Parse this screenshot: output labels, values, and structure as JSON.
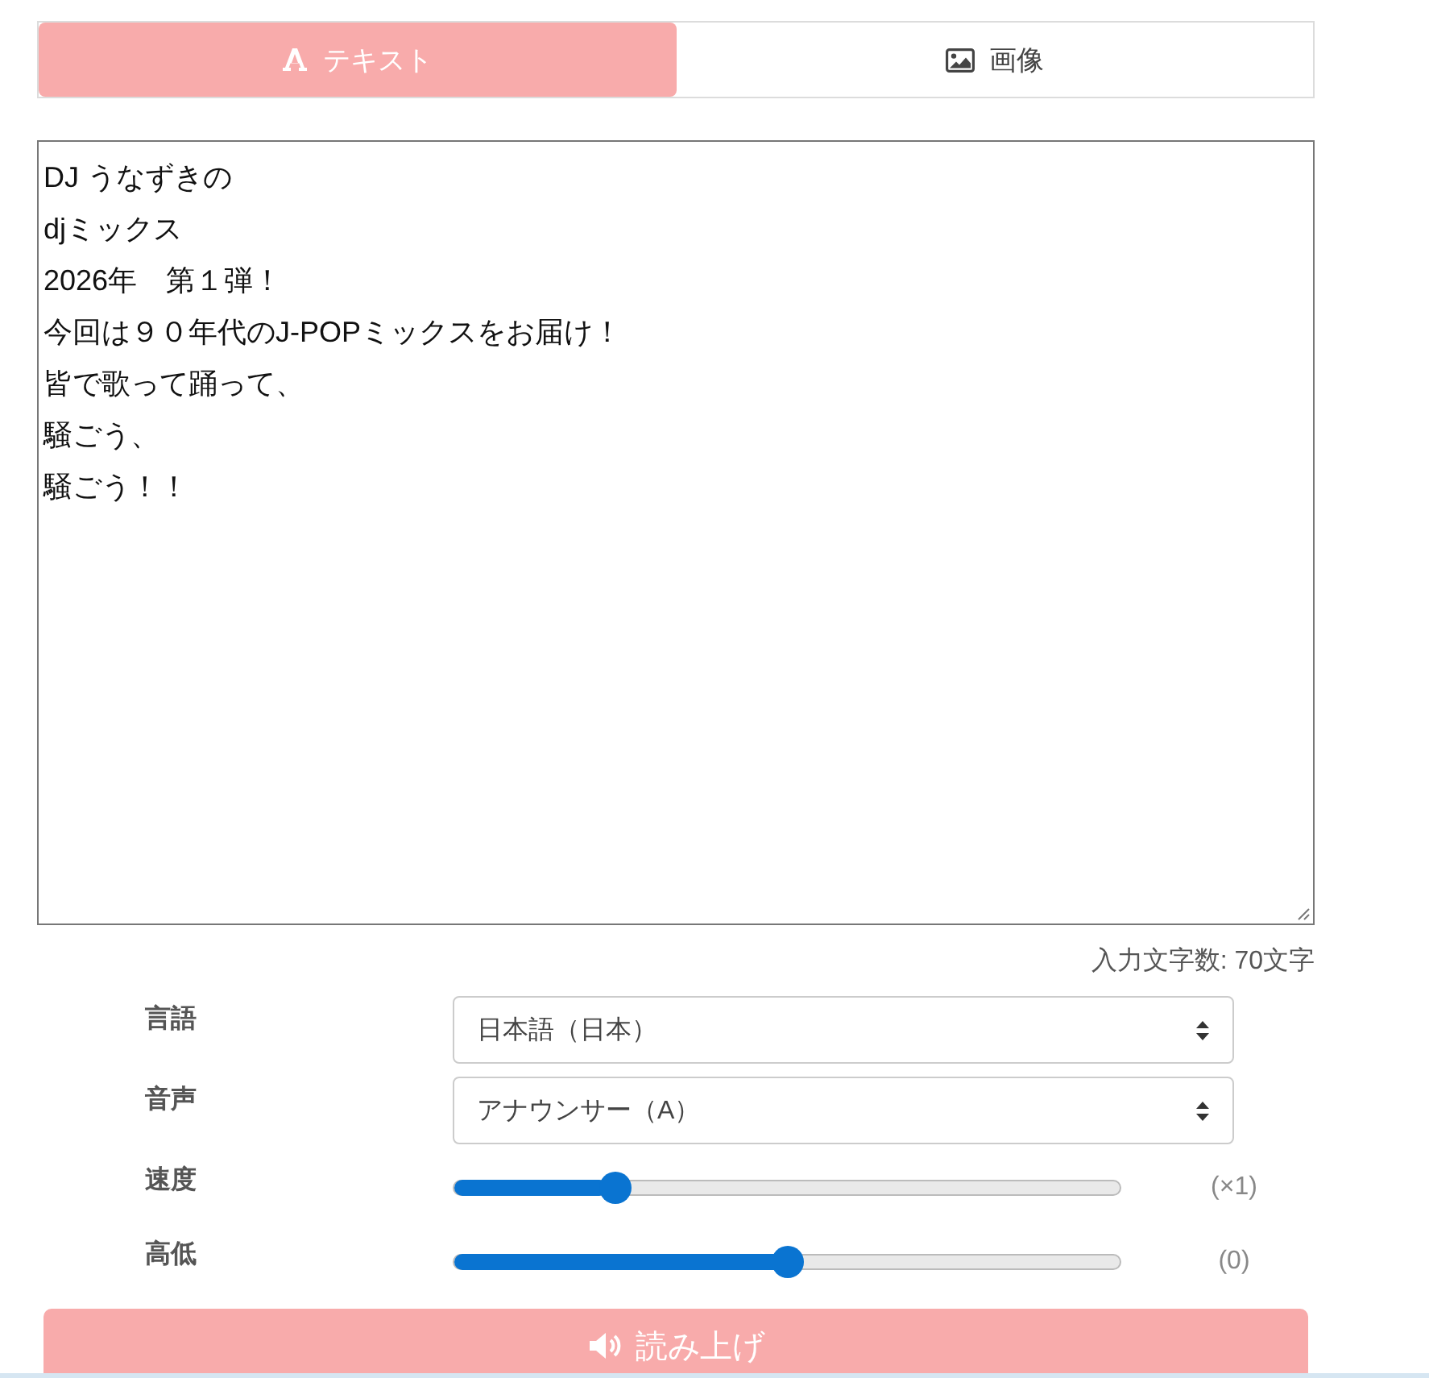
{
  "tabs": [
    {
      "label": "テキスト",
      "selected": true
    },
    {
      "label": "画像",
      "selected": false
    }
  ],
  "text_input": {
    "lines": [
      "DJ うなずきの",
      "djミックス",
      "2026年　第１弾！",
      "今回は９０年代のJ-POPミックスをお届け！",
      "皆で歌って踊って、",
      "騒ごう、",
      "騒ごう！！"
    ]
  },
  "char_count": "入力文字数: 70文字",
  "settings": [
    {
      "kind": "select",
      "label": "言語",
      "value": "日本語（日本）"
    },
    {
      "kind": "select",
      "label": "音声",
      "value": "アナウンサー（A）"
    },
    {
      "kind": "slider",
      "label": "速度",
      "level": 0.23,
      "reading": "(×1)"
    },
    {
      "kind": "slider",
      "label": "高低",
      "level": 0.5,
      "reading": "(0)"
    }
  ],
  "read_button": {
    "label": "読み上げ"
  }
}
